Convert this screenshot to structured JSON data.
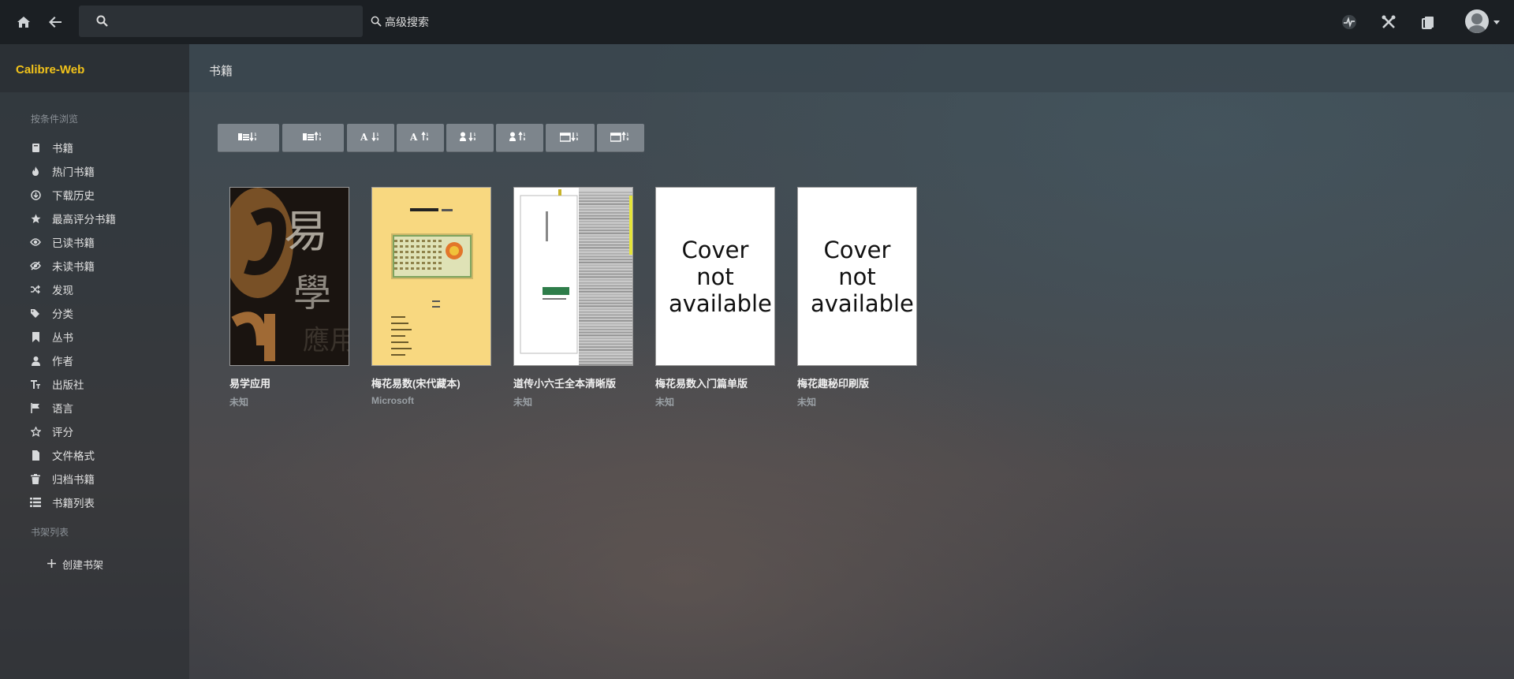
{
  "nav": {
    "search_placeholder": "",
    "advanced_search_label": "高级搜索"
  },
  "brand": "Calibre-Web",
  "page_title": "书籍",
  "sidebar": {
    "browse_heading": "按条件浏览",
    "items": [
      {
        "label": "书籍",
        "icon": "book-icon"
      },
      {
        "label": "热门书籍",
        "icon": "fire-icon"
      },
      {
        "label": "下载历史",
        "icon": "download-icon"
      },
      {
        "label": "最高评分书籍",
        "icon": "star-icon"
      },
      {
        "label": "已读书籍",
        "icon": "eye-icon"
      },
      {
        "label": "未读书籍",
        "icon": "eye-slash-icon"
      },
      {
        "label": "发现",
        "icon": "shuffle-icon"
      },
      {
        "label": "分类",
        "icon": "tags-icon"
      },
      {
        "label": "丛书",
        "icon": "bookmark-icon"
      },
      {
        "label": "作者",
        "icon": "user-icon"
      },
      {
        "label": "出版社",
        "icon": "text-size-icon"
      },
      {
        "label": "语言",
        "icon": "flag-icon"
      },
      {
        "label": "评分",
        "icon": "star-empty-icon"
      },
      {
        "label": "文件格式",
        "icon": "file-icon"
      },
      {
        "label": "归档书籍",
        "icon": "trash-icon"
      },
      {
        "label": "书籍列表",
        "icon": "list-icon"
      }
    ],
    "shelves_heading": "书架列表",
    "create_shelf": "创建书架"
  },
  "sort_buttons": [
    {
      "name": "sort-newest-button",
      "icon": "book-date-desc-icon"
    },
    {
      "name": "sort-oldest-button",
      "icon": "book-date-asc-icon"
    },
    {
      "name": "sort-title-asc-button",
      "icon": "alpha-asc-icon"
    },
    {
      "name": "sort-title-desc-button",
      "icon": "alpha-desc-icon"
    },
    {
      "name": "sort-author-asc-button",
      "icon": "author-asc-icon"
    },
    {
      "name": "sort-author-desc-button",
      "icon": "author-desc-icon"
    },
    {
      "name": "sort-pubdate-asc-button",
      "icon": "calendar-asc-icon"
    },
    {
      "name": "sort-pubdate-desc-button",
      "icon": "calendar-desc-icon"
    }
  ],
  "books": [
    {
      "title": "易学应用",
      "author": "未知",
      "cover": "calligraphy"
    },
    {
      "title": "梅花易数(宋代藏本)",
      "author": "Microsoft",
      "cover": "yellow"
    },
    {
      "title": "道传小六壬全本清晰版",
      "author": "未知",
      "cover": "scan"
    },
    {
      "title": "梅花易数入门篇单版",
      "author": "未知",
      "cover": "placeholder",
      "placeholder_text": "Cover not available"
    },
    {
      "title": "梅花趣秘印刷版",
      "author": "未知",
      "cover": "placeholder",
      "placeholder_text": "Cover not available"
    }
  ],
  "colors": {
    "brand": "#f2c31a",
    "navbar": "#1b1f23",
    "button": "#7d858c"
  }
}
